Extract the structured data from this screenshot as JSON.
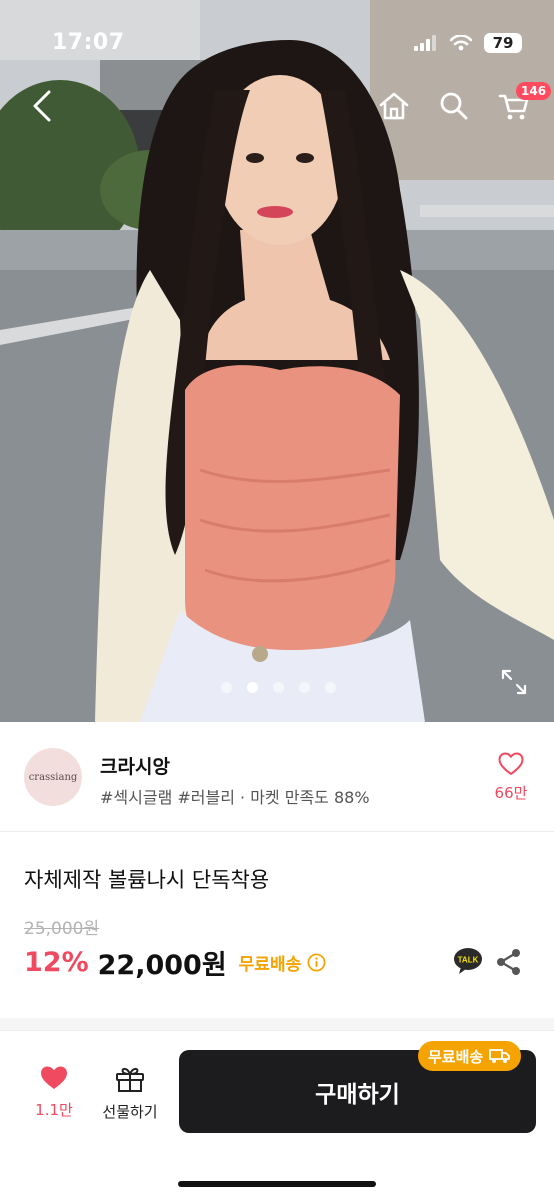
{
  "status": {
    "time": "17:07",
    "battery": "79"
  },
  "nav": {
    "cart_count": "146"
  },
  "carousel": {
    "total": 5,
    "active_index": 1
  },
  "shop": {
    "avatar_text": "crassiang",
    "name": "크라시앙",
    "tags": "#섹시글램 #러블리 · 마켓 만족도 88%",
    "like_count": "66만"
  },
  "product": {
    "title": "자체제작 볼륨나시 단독착용",
    "original_price": "25,000원",
    "discount": "12%",
    "price": "22,000원",
    "shipping": "무료배송",
    "talk_label": "TALK"
  },
  "bottom": {
    "like_count": "1.1만",
    "gift_label": "선물하기",
    "buy_label": "구매하기",
    "ship_badge": "무료배송"
  },
  "colors": {
    "accent_pink": "#ef4a60",
    "shipping_orange": "#f5a300",
    "buy_button": "#1c1c1e",
    "badge_red": "#ff4a5f"
  },
  "icons": [
    "back-icon",
    "home-icon",
    "search-icon",
    "cart-icon",
    "expand-icon",
    "heart-icon",
    "info-icon",
    "kakaotalk-icon",
    "share-icon",
    "gift-icon",
    "truck-icon"
  ]
}
